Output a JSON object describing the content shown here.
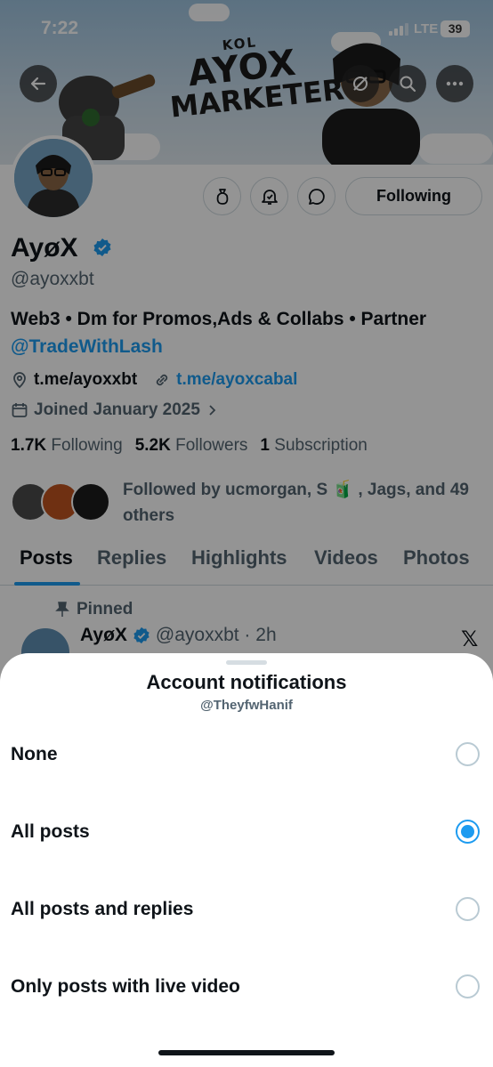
{
  "status_bar": {
    "time": "7:22",
    "network": "LTE",
    "battery": "39"
  },
  "banner": {
    "line1": "KOL",
    "line2": "AYOX",
    "line3": "MARKETER"
  },
  "profile": {
    "name": "AyøX",
    "handle": "@ayoxxbt",
    "bio_line1": "Web3 • Dm for Promos,Ads & Collabs • Partner",
    "bio_mention": "@TradeWithLash",
    "link1": "t.me/ayoxxbt",
    "link2": "t.me/ayoxcabal",
    "joined": "Joined January 2025",
    "following_count": "1.7K",
    "following_label": "Following",
    "followers_count": "5.2K",
    "followers_label": "Followers",
    "subscription_count": "1",
    "subscription_label": "Subscription",
    "followed_by": "Followed by ucmorgan, S 🧃 , Jags, and 49 others",
    "following_button": "Following"
  },
  "tabs": [
    "Posts",
    "Replies",
    "Highlights",
    "Videos",
    "Photos"
  ],
  "pinned_post": {
    "pinned_label": "Pinned",
    "name": "AyøX",
    "handle_time": "@ayoxxbt · 2h",
    "x_logo": "𝕏"
  },
  "sheet": {
    "title": "Account notifications",
    "subtitle": "@TheyfwHanif",
    "options": [
      {
        "label": "None",
        "selected": false
      },
      {
        "label": "All posts",
        "selected": true
      },
      {
        "label": "All posts and replies",
        "selected": false
      },
      {
        "label": "Only posts with live video",
        "selected": false
      }
    ]
  },
  "colors": {
    "accent": "#1d9bf0",
    "text": "#0f1419",
    "muted": "#536471"
  }
}
